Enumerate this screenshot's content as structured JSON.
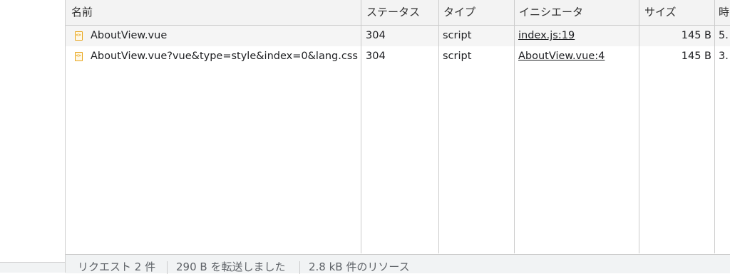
{
  "table": {
    "columns": {
      "name": "名前",
      "status": "ステータス",
      "type": "タイプ",
      "initiator": "イニシエータ",
      "size": "サイズ",
      "time": "時"
    },
    "rows": [
      {
        "icon": "script-file-icon",
        "name": "AboutView.vue",
        "status": "304",
        "type": "script",
        "initiator": "index.js:19",
        "size": "145 B",
        "time": "5."
      },
      {
        "icon": "script-file-icon",
        "name": "AboutView.vue?vue&type=style&index=0&lang.css",
        "status": "304",
        "type": "script",
        "initiator": "AboutView.vue:4",
        "size": "145 B",
        "time": "3."
      }
    ]
  },
  "footer": {
    "requests": "リクエスト 2 件",
    "transferred": "290 B を転送しました",
    "resources": "2.8 kB 件のリソース"
  }
}
